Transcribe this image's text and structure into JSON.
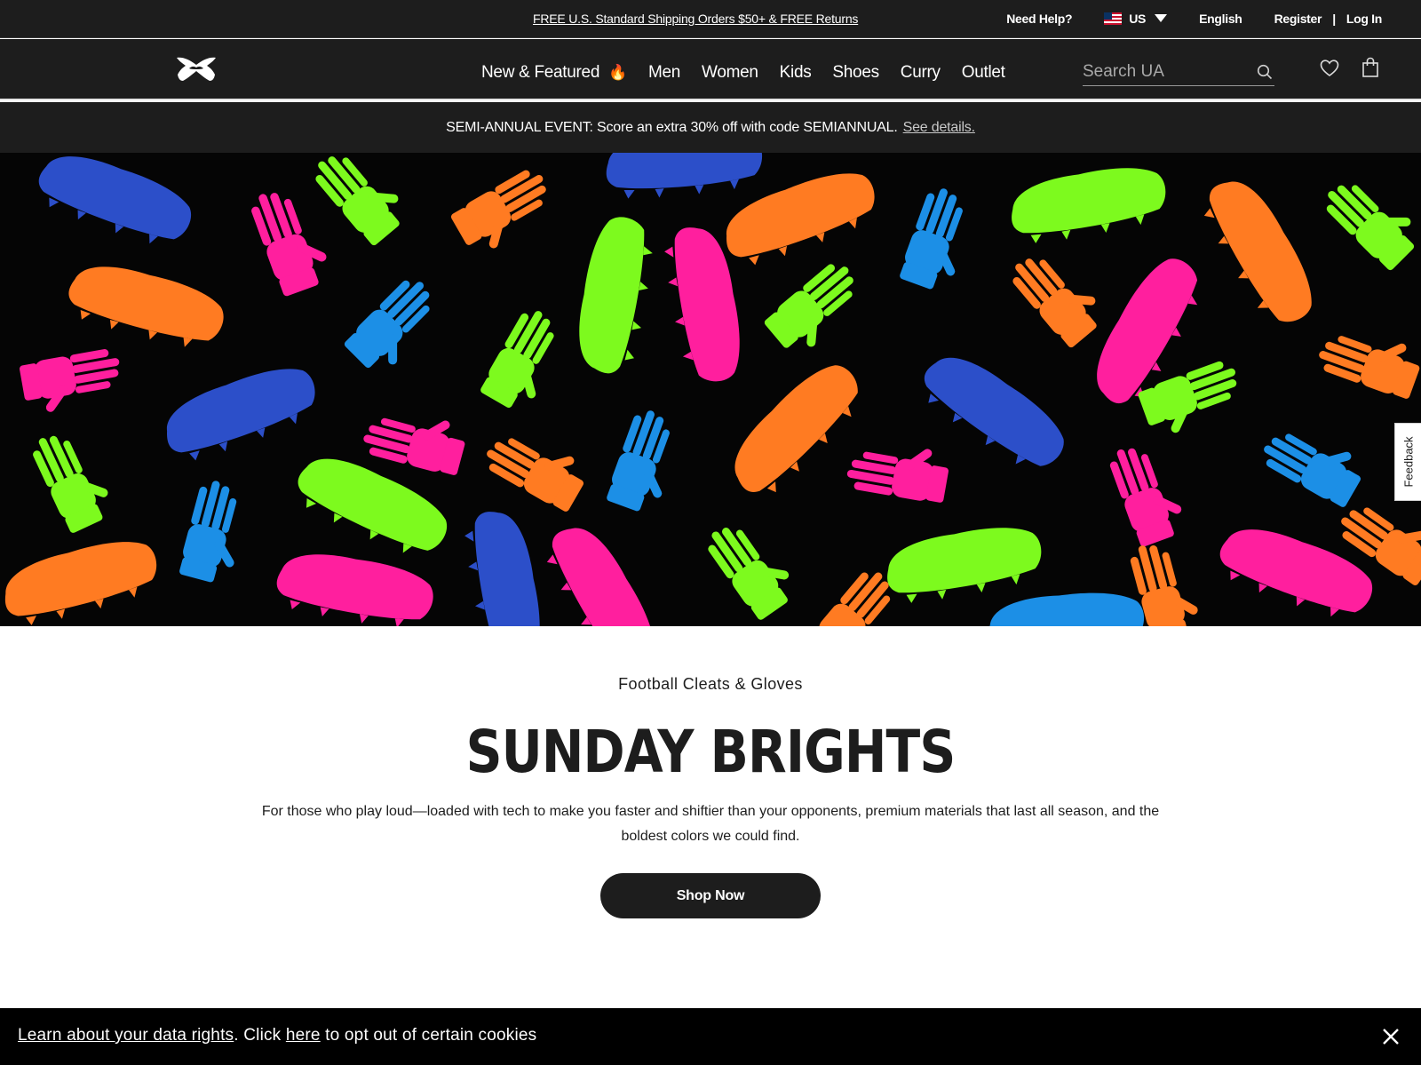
{
  "utility_bar": {
    "promo_link": "FREE U.S. Standard Shipping Orders $50+ & FREE Returns",
    "need_help": "Need Help?",
    "country": "US",
    "language": "English",
    "register": "Register",
    "separator": "|",
    "login": "Log In"
  },
  "nav": {
    "items": [
      "New & Featured",
      "Men",
      "Women",
      "Kids",
      "Shoes",
      "Curry",
      "Outlet"
    ],
    "search_placeholder": "Search UA"
  },
  "promo_banner": {
    "text": "SEMI-ANNUAL EVENT: Score an extra 30% off with code SEMIANNUAL.",
    "link": "See details."
  },
  "feedback_tab": "Feedback",
  "hero_content": {
    "eyebrow": "Football Cleats & Gloves",
    "title": "SUNDAY BRIGHTS",
    "description": "For those who play loud—loaded with tech to make you faster and shiftier than your opponents, premium materials that last all season, and the boldest colors we could find.",
    "cta": "Shop Now"
  },
  "cookie_bar": {
    "link1": "Learn about your data rights",
    "mid": ". Click ",
    "link2": "here",
    "tail": " to opt out of certain cookies"
  },
  "colors": {
    "dark": "#1d1d1d",
    "neon_pink": "#ff1f9e",
    "neon_green": "#7dfa1e",
    "neon_orange": "#ff7b22",
    "neon_blue": "#1c8fe6",
    "royal_blue": "#2c4fc9",
    "flame": "#ff8a1c"
  }
}
